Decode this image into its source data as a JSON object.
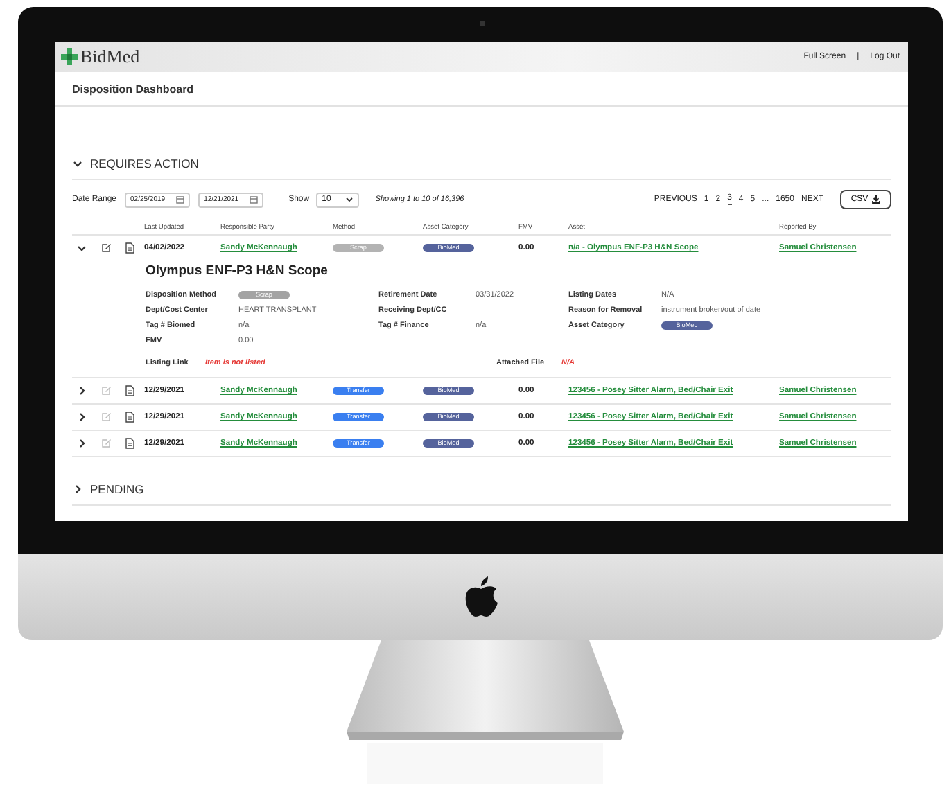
{
  "header": {
    "logo": "BidMed",
    "links": [
      "Full Screen",
      "Log Out"
    ],
    "separator": "|"
  },
  "page_title": "Disposition Dashboard",
  "sections": [
    {
      "title": "REQUIRES ACTION",
      "expanded": true,
      "filters": {
        "date_range_label": "Date Range",
        "date_from": "02/25/2019",
        "date_to": "12/21/2021",
        "show_label": "Show",
        "show_value": "10",
        "showing": "Showing 1 to 10 of 16,396"
      },
      "pagination": {
        "previous": "PREVIOUS",
        "pages_start": [
          {
            "label": "1",
            "selected": false
          },
          {
            "label": "2",
            "selected": false
          },
          {
            "label": "3",
            "selected": true
          },
          {
            "label": "4",
            "selected": false
          },
          {
            "label": "5",
            "selected": false
          }
        ],
        "ellipsis": "...",
        "pages_end": [
          {
            "label": "1650",
            "selected": false
          }
        ],
        "next": "NEXT"
      },
      "export_button": "CSV",
      "columns": [
        "Last Updated",
        "Responsible Party",
        "Method",
        "Asset Category",
        "FMV",
        "Asset",
        "Reported By"
      ],
      "rows": [
        {
          "expanded": true,
          "edit_enabled": true,
          "updated": "04/02/2022",
          "party": "Sandy McKennaugh",
          "method": {
            "label": "Scrap",
            "color": "#b3b3b3"
          },
          "category": {
            "label": "BioMed",
            "color": "#55639c"
          },
          "fmv": "0.00",
          "asset": "n/a - Olympus ENF-P3 H&N Scope",
          "reporter": "Samuel Christensen",
          "details": {
            "title": "Olympus ENF-P3 H&N Scope",
            "fields": [
              {
                "kind": "pill",
                "label": "Disposition Method",
                "value": "Scrap",
                "color": "#a3a3a3"
              },
              {
                "kind": "text",
                "label": "Retirement Date",
                "value": "03/31/2022"
              },
              {
                "kind": "text",
                "label": "Listing Dates",
                "value": "N/A"
              },
              {
                "kind": "text",
                "label": "Dept/Cost Center",
                "value": "HEART TRANSPLANT"
              },
              {
                "kind": "text",
                "label": "Receiving Dept/CC"
              },
              {
                "kind": "text",
                "label": "Reason for Removal",
                "value": "instrument broken/out of date"
              },
              {
                "kind": "text",
                "label": "Tag # Biomed",
                "value": "n/a"
              },
              {
                "kind": "text",
                "label": "Tag # Finance",
                "value": "n/a"
              },
              {
                "kind": "pill",
                "label": "Asset Category",
                "value": "BioMed",
                "color": "#55639c"
              },
              {
                "kind": "text",
                "label": "FMV",
                "value": "0.00"
              }
            ],
            "listing_link_label": "Listing Link",
            "listing_link_value": "Item is not listed",
            "attached_file_label": "Attached File",
            "attached_file_value": "N/A"
          }
        },
        {
          "expanded": false,
          "edit_enabled": false,
          "updated": "12/29/2021",
          "party": "Sandy McKennaugh",
          "method": {
            "label": "Transfer",
            "color": "#3a7ff0"
          },
          "category": {
            "label": "BioMed",
            "color": "#55639c"
          },
          "fmv": "0.00",
          "asset": "123456 - Posey Sitter Alarm, Bed/Chair Exit",
          "reporter": "Samuel Christensen"
        },
        {
          "expanded": false,
          "edit_enabled": false,
          "updated": "12/29/2021",
          "party": "Sandy McKennaugh",
          "method": {
            "label": "Transfer",
            "color": "#3a7ff0"
          },
          "category": {
            "label": "BioMed",
            "color": "#55639c"
          },
          "fmv": "0.00",
          "asset": "123456 - Posey Sitter Alarm, Bed/Chair Exit",
          "reporter": "Samuel Christensen"
        },
        {
          "expanded": false,
          "edit_enabled": false,
          "updated": "12/29/2021",
          "party": "Sandy McKennaugh",
          "method": {
            "label": "Transfer",
            "color": "#3a7ff0"
          },
          "category": {
            "label": "BioMed",
            "color": "#55639c"
          },
          "fmv": "0.00",
          "asset": "123456 - Posey Sitter Alarm, Bed/Chair Exit",
          "reporter": "Samuel Christensen"
        }
      ]
    },
    {
      "title": "PENDING",
      "expanded": false
    }
  ]
}
